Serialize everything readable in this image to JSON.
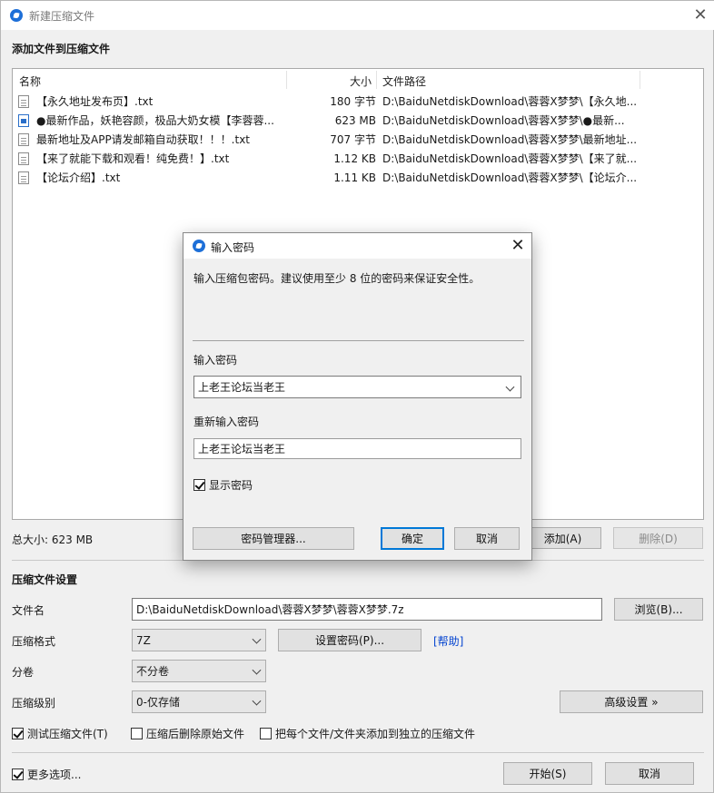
{
  "window": {
    "title": "新建压缩文件",
    "close_glyph": "✕"
  },
  "add_section": {
    "title": "添加文件到压缩文件",
    "columns": [
      "名称",
      "大小",
      "文件路径"
    ],
    "files": [
      {
        "icon": "text-file-icon",
        "name": "【永久地址发布页】.txt",
        "size": "180 字节",
        "path": "D:\\BaiduNetdiskDownload\\蓉蓉X梦梦\\【永久地..."
      },
      {
        "icon": "image-file-icon",
        "name": "●最新作品，妖艳容颜，极品大奶女模【李蓉蓉...",
        "size": "623 MB",
        "path": "D:\\BaiduNetdiskDownload\\蓉蓉X梦梦\\●最新..."
      },
      {
        "icon": "text-file-icon",
        "name": "最新地址及APP请发邮箱自动获取！！！.txt",
        "size": "707 字节",
        "path": "D:\\BaiduNetdiskDownload\\蓉蓉X梦梦\\最新地址..."
      },
      {
        "icon": "text-file-icon",
        "name": "【来了就能下载和观看！纯免费！】.txt",
        "size": "1.12 KB",
        "path": "D:\\BaiduNetdiskDownload\\蓉蓉X梦梦\\【来了就..."
      },
      {
        "icon": "text-file-icon",
        "name": "【论坛介绍】.txt",
        "size": "1.11 KB",
        "path": "D:\\BaiduNetdiskDownload\\蓉蓉X梦梦\\【论坛介..."
      }
    ],
    "total_size": "总大小: 623 MB",
    "add_button": "添加(A)",
    "delete_button": "删除(D)"
  },
  "settings": {
    "title": "压缩文件设置",
    "filename_label": "文件名",
    "filename_value": "D:\\BaiduNetdiskDownload\\蓉蓉X梦梦\\蓉蓉X梦梦.7z",
    "browse_button": "浏览(B)...",
    "format_label": "压缩格式",
    "format_value": "7Z",
    "set_password_button": "设置密码(P)...",
    "help_link": "[帮助]",
    "split_label": "分卷",
    "split_value": "不分卷",
    "level_label": "压缩级别",
    "level_value": "0-仅存储",
    "advanced_button": "高级设置 »",
    "test_archive": {
      "label": "测试压缩文件(T)",
      "checked": true
    },
    "delete_after": {
      "label": "压缩后删除原始文件",
      "checked": false
    },
    "each_separate": {
      "label": "把每个文件/文件夹添加到独立的压缩文件",
      "checked": false
    },
    "more_options": {
      "label": "更多选项...",
      "checked": true
    },
    "start_button": "开始(S)",
    "cancel_button": "取消"
  },
  "password_dialog": {
    "title": "输入密码",
    "hint": "输入压缩包密码。建议使用至少 8 位的密码来保证安全性。",
    "password_label": "输入密码",
    "password_value": "上老王论坛当老王",
    "reenter_label": "重新输入密码",
    "reenter_value": "上老王论坛当老王",
    "show_password": {
      "label": "显示密码",
      "checked": true
    },
    "manager_button": "密码管理器...",
    "ok_button": "确定",
    "cancel_button": "取消"
  }
}
